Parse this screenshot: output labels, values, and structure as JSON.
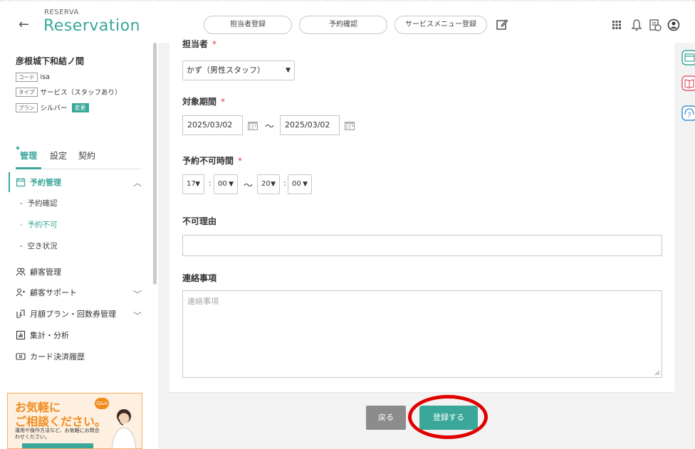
{
  "header": {
    "back_icon": "arrow-left-icon",
    "brand_small": "RESERVA",
    "brand": "Reservation",
    "nav": [
      "担当者登録",
      "予約確認",
      "サービスメニュー登録"
    ],
    "icons": [
      "edit-icon",
      "grid-icon",
      "bell-icon",
      "calendar-doc-icon",
      "user-circle-icon"
    ]
  },
  "sidebar": {
    "shop_name": "彦根城下和結ノ間",
    "code_tag": "コード",
    "code_value": "isa",
    "type_tag": "タイプ",
    "type_value": "サービス（スタッフあり）",
    "plan_tag": "プラン",
    "plan_value": "シルバー",
    "plan_change": "変更",
    "tabs": [
      "管理",
      "設定",
      "契約"
    ],
    "menu": {
      "reservation_mgmt": "予約管理",
      "sub_confirm": "予約確認",
      "sub_unavailable": "予約不可",
      "sub_availability": "空き状況",
      "customer_mgmt": "顧客管理",
      "customer_support": "顧客サポート",
      "monthly_plan": "月額プラン・回数券管理",
      "analytics": "集計・分析",
      "card_history": "カード決済履歴"
    },
    "banner": {
      "line1": "お気軽に",
      "line2": "ご相談ください。",
      "line3": "運用や操作方法など、お気軽にお問合わせください。",
      "qa": "Q&A"
    }
  },
  "form": {
    "staff_label": "担当者",
    "required_mark": "*",
    "staff_value": "かず（男性スタッフ）",
    "period_label": "対象期間",
    "date_from": "2025/03/02",
    "date_to": "2025/03/02",
    "tilde": "〜",
    "time_label": "予約不可時間",
    "time_from_h": "17",
    "time_from_m": "00",
    "time_to_h": "20",
    "time_to_m": "00",
    "colon": ":",
    "reason_label": "不可理由",
    "reason_value": "",
    "contact_label": "連絡事項",
    "contact_placeholder": "連絡事項"
  },
  "buttons": {
    "back": "戻る",
    "submit": "登録する"
  },
  "colors": {
    "accent": "#3aa79a",
    "required": "#e04545",
    "highlight": "#e00000"
  }
}
